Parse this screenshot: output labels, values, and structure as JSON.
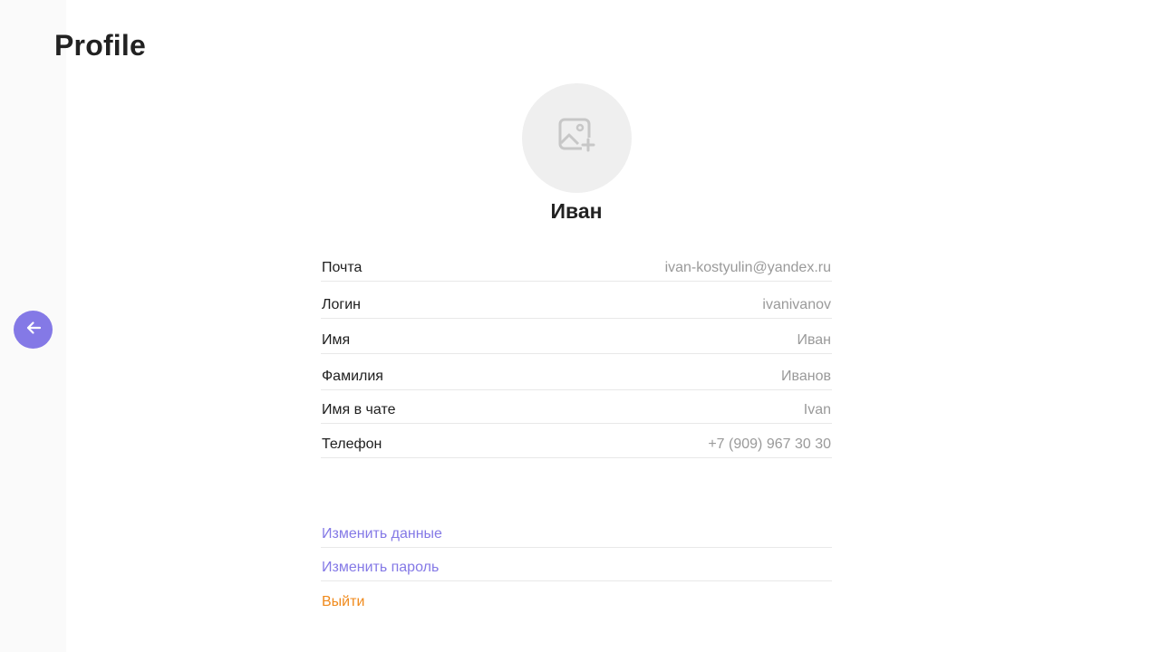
{
  "page": {
    "title": "Profile"
  },
  "profile": {
    "display_name": "Иван"
  },
  "fields": [
    {
      "label": "Почта",
      "value": "ivan-kostyulin@yandex.ru"
    },
    {
      "label": "Логин",
      "value": "ivanivanov"
    },
    {
      "label": "Имя",
      "value": "Иван"
    },
    {
      "label": "Фамилия",
      "value": "Иванов"
    },
    {
      "label": "Имя в чате",
      "value": "Ivan"
    },
    {
      "label": "Телефон",
      "value": "+7 (909) 967 30 30"
    }
  ],
  "actions": {
    "edit_data": "Изменить данные",
    "change_password": "Изменить пароль",
    "logout": "Выйти"
  },
  "icons": {
    "back": "arrow-left-icon",
    "avatar_placeholder": "image-add-icon"
  },
  "colors": {
    "accent": "#8479e6",
    "danger": "#f08a1c",
    "muted": "#9a9a9a",
    "sidebar_bg": "#fafafa",
    "avatar_bg": "#efefef"
  }
}
